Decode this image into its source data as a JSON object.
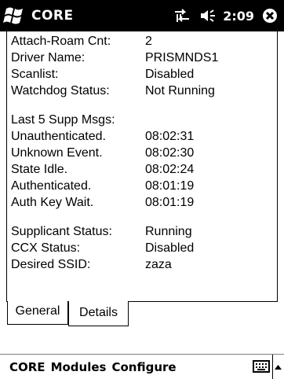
{
  "titlebar": {
    "start_icon": "windows-flag-icon",
    "app_title": "CORE",
    "connectivity_icon": "connectivity-icon",
    "volume_icon": "speaker-icon",
    "time": "2:09",
    "close_icon": "close-icon"
  },
  "details": {
    "group1": [
      {
        "label": "Attach-Roam Cnt:",
        "value": "2"
      },
      {
        "label": "Driver Name:",
        "value": "PRISMNDS1"
      },
      {
        "label": "Scanlist:",
        "value": "Disabled"
      },
      {
        "label": "Watchdog Status:",
        "value": "Not Running"
      }
    ],
    "supp_header": "Last 5 Supp Msgs:",
    "supp_msgs": [
      {
        "label": "Unauthenticated.",
        "value": "08:02:31"
      },
      {
        "label": "Unknown Event.",
        "value": "08:02:30"
      },
      {
        "label": "State Idle.",
        "value": "08:02:24"
      },
      {
        "label": "Authenticated.",
        "value": "08:01:19"
      },
      {
        "label": "Auth Key Wait.",
        "value": "08:01:19"
      }
    ],
    "group3": [
      {
        "label": "Supplicant Status:",
        "value": "Running"
      },
      {
        "label": "CCX Status:",
        "value": "Disabled"
      },
      {
        "label": "Desired SSID:",
        "value": "zaza"
      }
    ]
  },
  "tabs": [
    {
      "label": "General",
      "selected": false
    },
    {
      "label": "Details",
      "selected": true
    }
  ],
  "menubar": {
    "items": [
      "CORE",
      "Modules",
      "Configure"
    ],
    "sip_icon": "keyboard-icon",
    "sip_arrow_icon": "arrow-up-icon"
  }
}
